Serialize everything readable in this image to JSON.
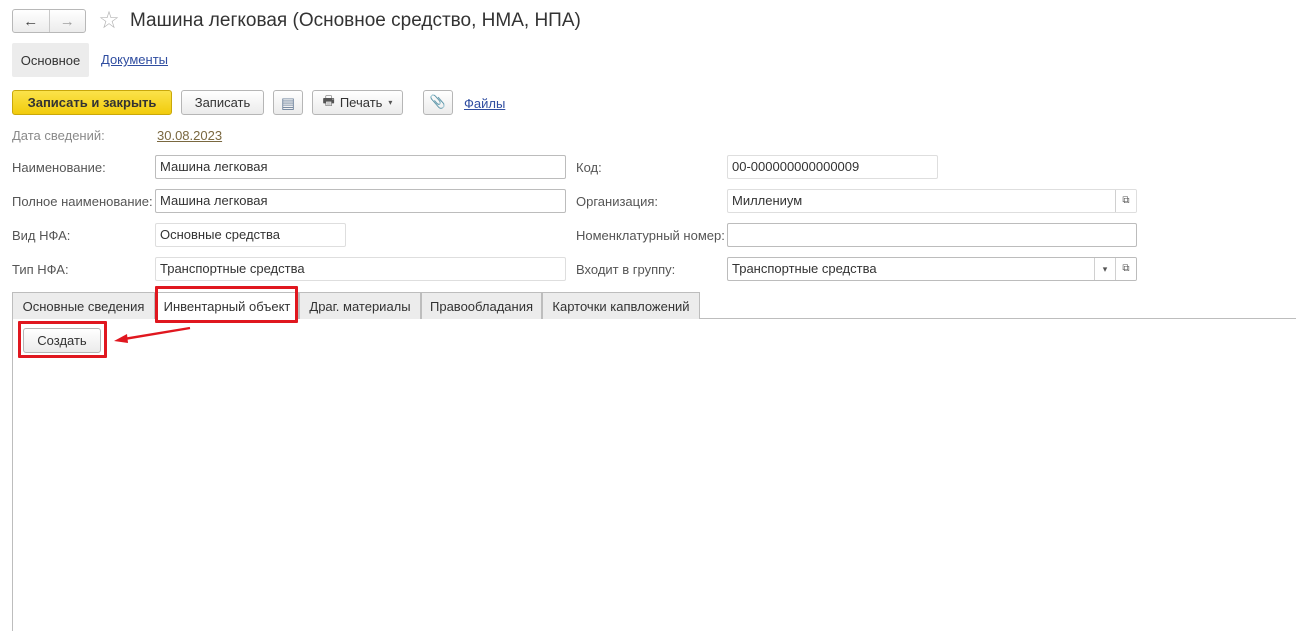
{
  "window": {
    "title": "Машина легковая (Основное средство, НМА, НПА)",
    "back_icon": "←",
    "forward_icon": "→",
    "favorite_icon": "☆"
  },
  "page_tabs": [
    {
      "label": "Основное",
      "active": true
    },
    {
      "label": "Документы",
      "active": false
    }
  ],
  "toolbar": {
    "save_close_label": "Записать и закрыть",
    "save_label": "Записать",
    "list_icon": "▤",
    "print_icon": "🖶",
    "print_label": "Печать",
    "caret": "▾",
    "attach_icon": "📎",
    "files_label": "Файлы",
    "accent_color": "#f5d21f"
  },
  "form": {
    "date_label": "Дата сведений:",
    "date_value": "30.08.2023",
    "name_label": "Наименование:",
    "name_value": "Машина легковая",
    "fullname_label": "Полное наименование:",
    "fullname_value": "Машина легковая",
    "nfa_kind_label": "Вид НФА:",
    "nfa_kind_value": "Основные средства",
    "nfa_type_label": "Тип НФА:",
    "nfa_type_value": "Транспортные средства",
    "code_label": "Код:",
    "code_value": "00-000000000000009",
    "org_label": "Организация:",
    "org_value": "Миллениум",
    "nomenclature_label": "Номенклатурный номер:",
    "nomenclature_value": "",
    "group_label": "Входит в группу:",
    "group_value": "Транспортные средства",
    "open_icon": "⧉",
    "dropdown_icon": "▾"
  },
  "form_tabs": [
    {
      "label": "Основные сведения",
      "active": false
    },
    {
      "label": "Инвентарный объект",
      "active": true
    },
    {
      "label": "Драг. материалы",
      "active": false
    },
    {
      "label": "Правообладания",
      "active": false
    },
    {
      "label": "Карточки капвложений",
      "active": false
    }
  ],
  "tab_content": {
    "create_label": "Создать"
  },
  "annotation": {
    "highlight_color": "#e0171f"
  }
}
